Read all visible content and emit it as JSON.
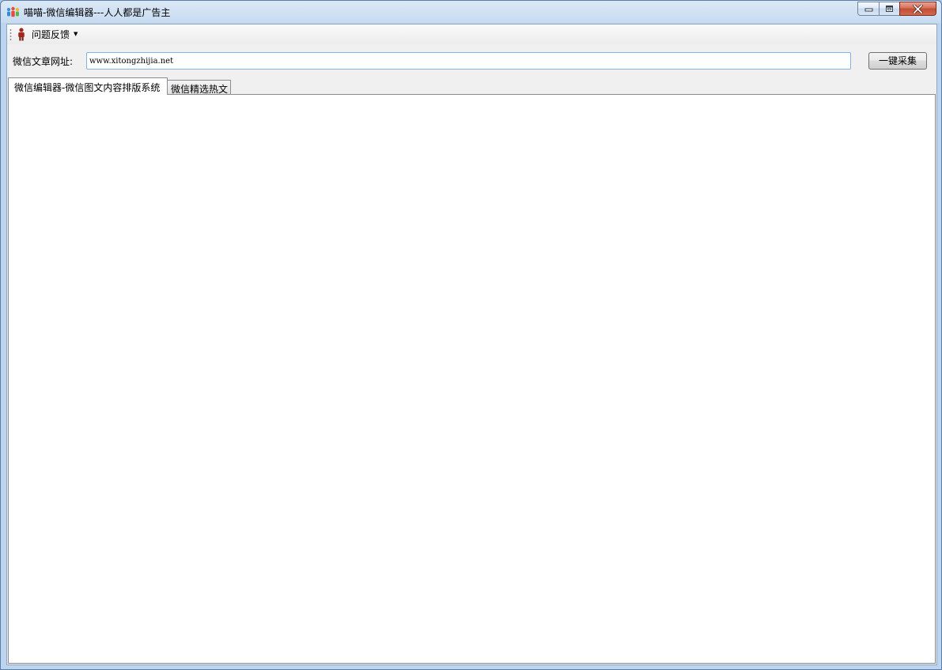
{
  "window": {
    "title": "喵喵-微信编辑器---人人都是广告主",
    "app_icon": "people-group-icon",
    "controls": {
      "minimize_icon": "minimize-icon",
      "maximize_icon": "maximize-icon",
      "close_icon": "close-icon"
    }
  },
  "toolbar": {
    "feedback_menu": {
      "label": "问题反馈",
      "icon": "person-icon",
      "dropdown_icon": "caret-down-icon"
    }
  },
  "url_bar": {
    "label": "微信文章网址:",
    "value": "www.xitongzhijia.net",
    "button_label": "一键采集"
  },
  "tabs": [
    {
      "label": "微信编辑器-微信图文内容排版系统",
      "active": true
    },
    {
      "label": "微信精选热文",
      "active": false
    }
  ],
  "colors": {
    "title_bar": "#c7dbf0",
    "close_button": "#c14c33",
    "input_border": "#7eb4ea",
    "client_background": "#f0f0f0",
    "content_background": "#ffffff"
  }
}
